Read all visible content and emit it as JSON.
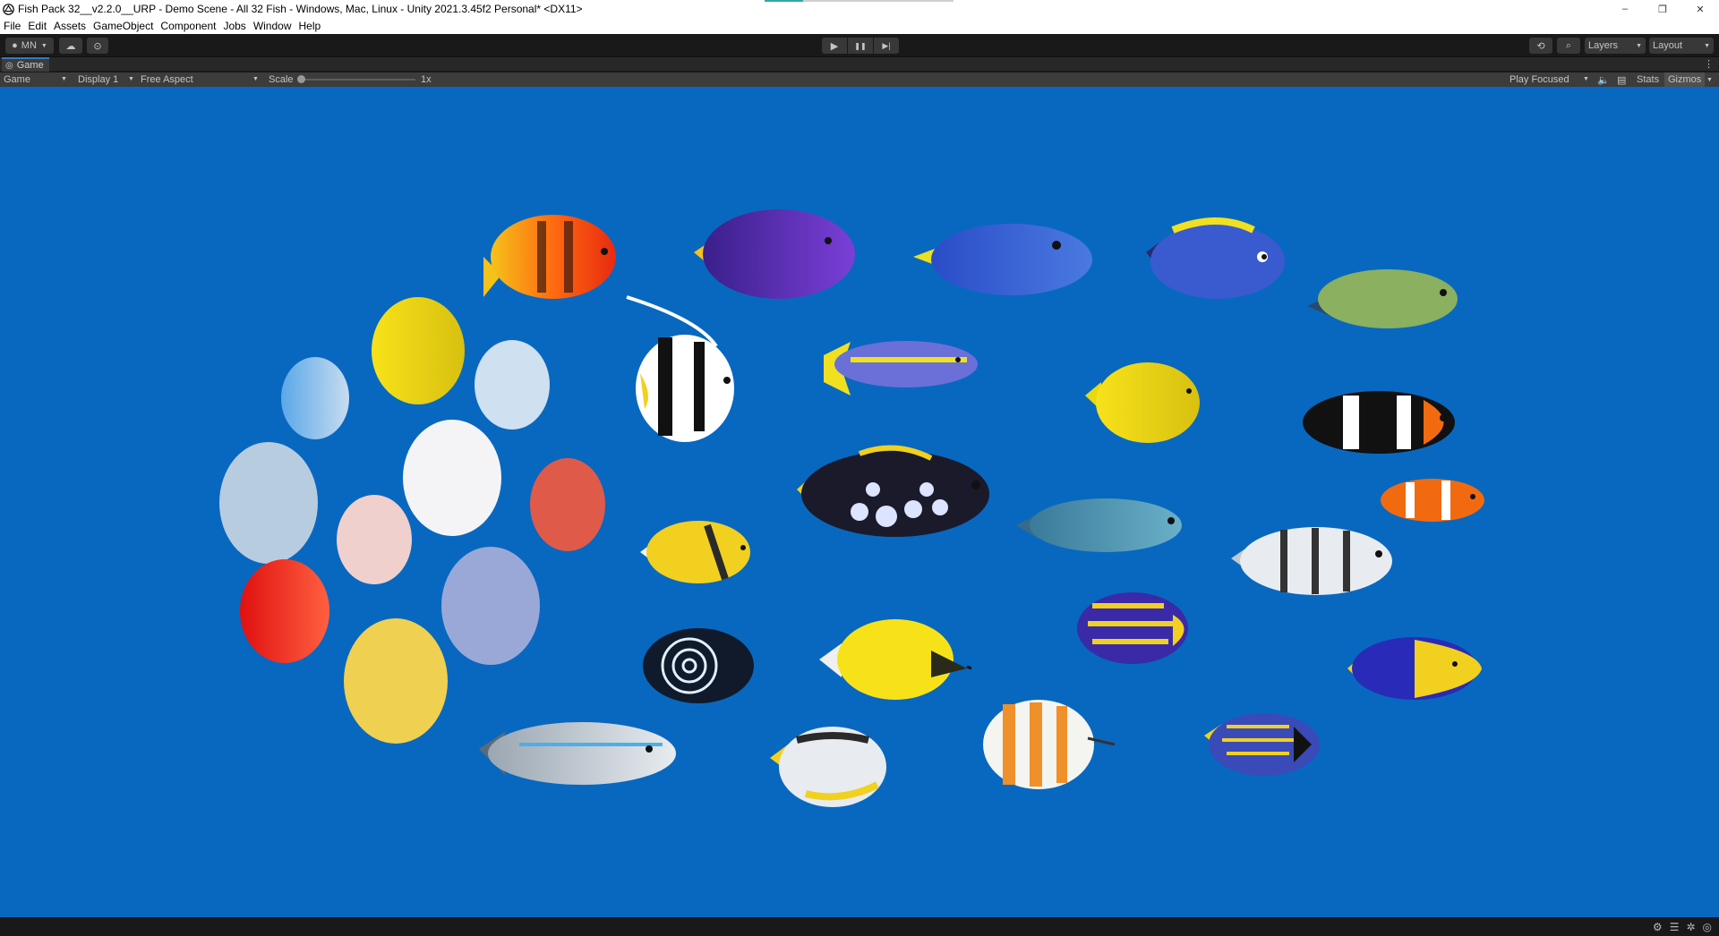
{
  "window": {
    "title": "Fish Pack 32__v2.2.0__URP - Demo Scene - All 32 Fish - Windows, Mac, Linux - Unity 2021.3.45f2 Personal* <DX11>",
    "controls": [
      "–",
      "❐",
      "✕"
    ]
  },
  "menu": [
    "File",
    "Edit",
    "Assets",
    "GameObject",
    "Component",
    "Jobs",
    "Window",
    "Help"
  ],
  "toolbar": {
    "account_label": "MN",
    "layers_label": "Layers",
    "layout_label": "Layout",
    "play_icon": "▶",
    "pause_icon": "❚❚",
    "step_icon": "▶|"
  },
  "game_tab": {
    "label": "Game"
  },
  "game_toolbar": {
    "view_select": "Game",
    "display_select": "Display 1",
    "aspect_select": "Free Aspect",
    "scale_label": "Scale",
    "scale_value": "1x",
    "scale_fraction": 0.0,
    "play_mode_select": "Play Focused",
    "stats_label": "Stats",
    "gizmos_label": "Gizmos"
  },
  "colors": {
    "game_background": "#0868bf",
    "editor_dark": "#191919",
    "toolbar_gray": "#3c3c3c",
    "tab_accent": "#3a79bb"
  }
}
